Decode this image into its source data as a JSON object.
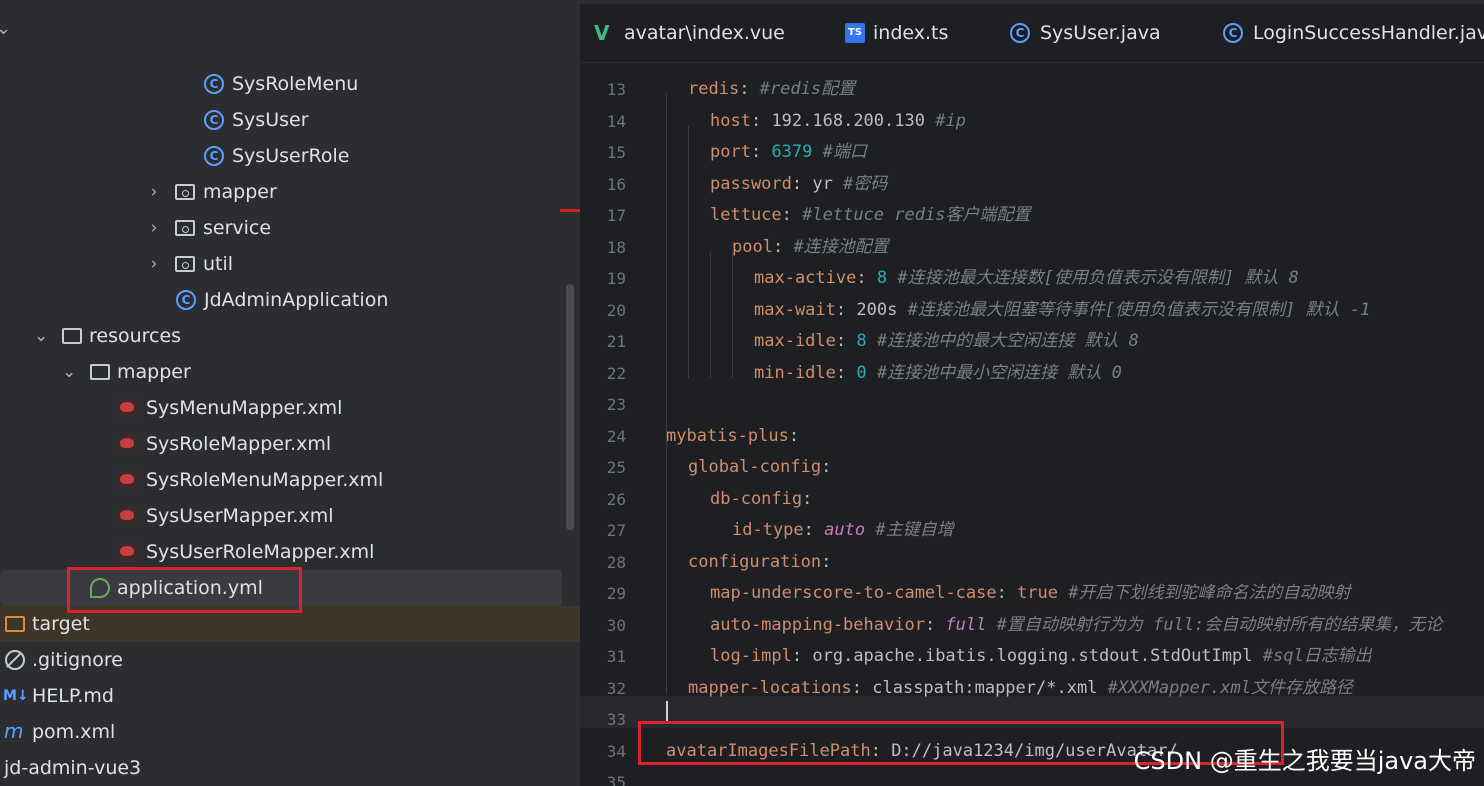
{
  "project_tree": {
    "rows": [
      {
        "label": "SysRoleMenu",
        "type": "class"
      },
      {
        "label": "SysUser",
        "type": "class"
      },
      {
        "label": "SysUserRole",
        "type": "class"
      },
      {
        "label": "mapper",
        "type": "package"
      },
      {
        "label": "service",
        "type": "package"
      },
      {
        "label": "util",
        "type": "package"
      },
      {
        "label": "JdAdminApplication",
        "type": "app-class"
      },
      {
        "label": "resources",
        "type": "resources-folder"
      },
      {
        "label": "mapper",
        "type": "folder"
      },
      {
        "label": "SysMenuMapper.xml",
        "type": "xml"
      },
      {
        "label": "SysRoleMapper.xml",
        "type": "xml"
      },
      {
        "label": "SysRoleMenuMapper.xml",
        "type": "xml"
      },
      {
        "label": "SysUserMapper.xml",
        "type": "xml"
      },
      {
        "label": "SysUserRoleMapper.xml",
        "type": "xml"
      },
      {
        "label": "application.yml",
        "type": "yml"
      },
      {
        "label": "target",
        "type": "target-folder"
      },
      {
        "label": ".gitignore",
        "type": "ignore"
      },
      {
        "label": "HELP.md",
        "type": "markdown"
      },
      {
        "label": "pom.xml",
        "type": "maven"
      },
      {
        "label": "jd-admin-vue3",
        "type": "module"
      }
    ]
  },
  "tabs": [
    {
      "label": "avatar\\index.vue",
      "icon": "vue-icon"
    },
    {
      "label": "index.ts",
      "icon": "ts-icon"
    },
    {
      "label": "SysUser.java",
      "icon": "class-icon"
    },
    {
      "label": "LoginSuccessHandler.java",
      "icon": "class-icon"
    }
  ],
  "editor": {
    "line_numbers": [
      "13",
      "14",
      "15",
      "16",
      "17",
      "18",
      "19",
      "20",
      "21",
      "22",
      "23",
      "24",
      "25",
      "26",
      "27",
      "28",
      "29",
      "30",
      "31",
      "32",
      "33",
      "34",
      "35"
    ],
    "lines": [
      {
        "key": "redis",
        "value": "",
        "comment": "#redis配置"
      },
      {
        "key": "host",
        "value": "192.168.200.130",
        "comment": "#ip"
      },
      {
        "key": "port",
        "value": "6379",
        "comment": "#端口"
      },
      {
        "key": "password",
        "value": "yr",
        "comment": "#密码"
      },
      {
        "key": "lettuce",
        "value": "",
        "comment": "#lettuce redis客户端配置"
      },
      {
        "key": "pool",
        "value": "",
        "comment": "#连接池配置"
      },
      {
        "key": "max-active",
        "value": "8",
        "comment": "#连接池最大连接数[使用负值表示没有限制] 默认 8"
      },
      {
        "key": "max-wait",
        "value": "200s",
        "comment": "#连接池最大阻塞等待事件[使用负值表示没有限制] 默认 -1"
      },
      {
        "key": "max-idle",
        "value": "8",
        "comment": "#连接池中的最大空闲连接 默认 8"
      },
      {
        "key": "min-idle",
        "value": "0",
        "comment": "#连接池中最小空闲连接 默认 0"
      },
      {
        "key": "",
        "value": "",
        "comment": ""
      },
      {
        "key": "mybatis-plus",
        "value": "",
        "comment": ""
      },
      {
        "key": "global-config",
        "value": "",
        "comment": ""
      },
      {
        "key": "db-config",
        "value": "",
        "comment": ""
      },
      {
        "key": "id-type",
        "value": "auto",
        "comment": "#主键自增"
      },
      {
        "key": "configuration",
        "value": "",
        "comment": ""
      },
      {
        "key": "map-underscore-to-camel-case",
        "value": "true",
        "comment": "#开启下划线到驼峰命名法的自动映射"
      },
      {
        "key": "auto-mapping-behavior",
        "value": "full",
        "comment": "#置自动映射行为为 full:会自动映射所有的结果集，无论"
      },
      {
        "key": "log-impl",
        "value": "org.apache.ibatis.logging.stdout.StdOutImpl",
        "comment": "#sql日志输出"
      },
      {
        "key": "mapper-locations",
        "value": "classpath:mapper/*.xml",
        "comment": "#XXXMapper.xml文件存放路径"
      },
      {
        "key": "",
        "value": "",
        "comment": ""
      },
      {
        "key": "avatarImagesFilePath",
        "value": "D://java1234/img/userAvatar/",
        "comment": ""
      },
      {
        "key": "",
        "value": "",
        "comment": ""
      }
    ]
  },
  "watermark": "CSDN @重生之我要当java大帝",
  "colors": {
    "highlight_box": "#e0202a",
    "key": "#cf8e6d",
    "number": "#2aacb8",
    "comment": "#7a7e85"
  }
}
